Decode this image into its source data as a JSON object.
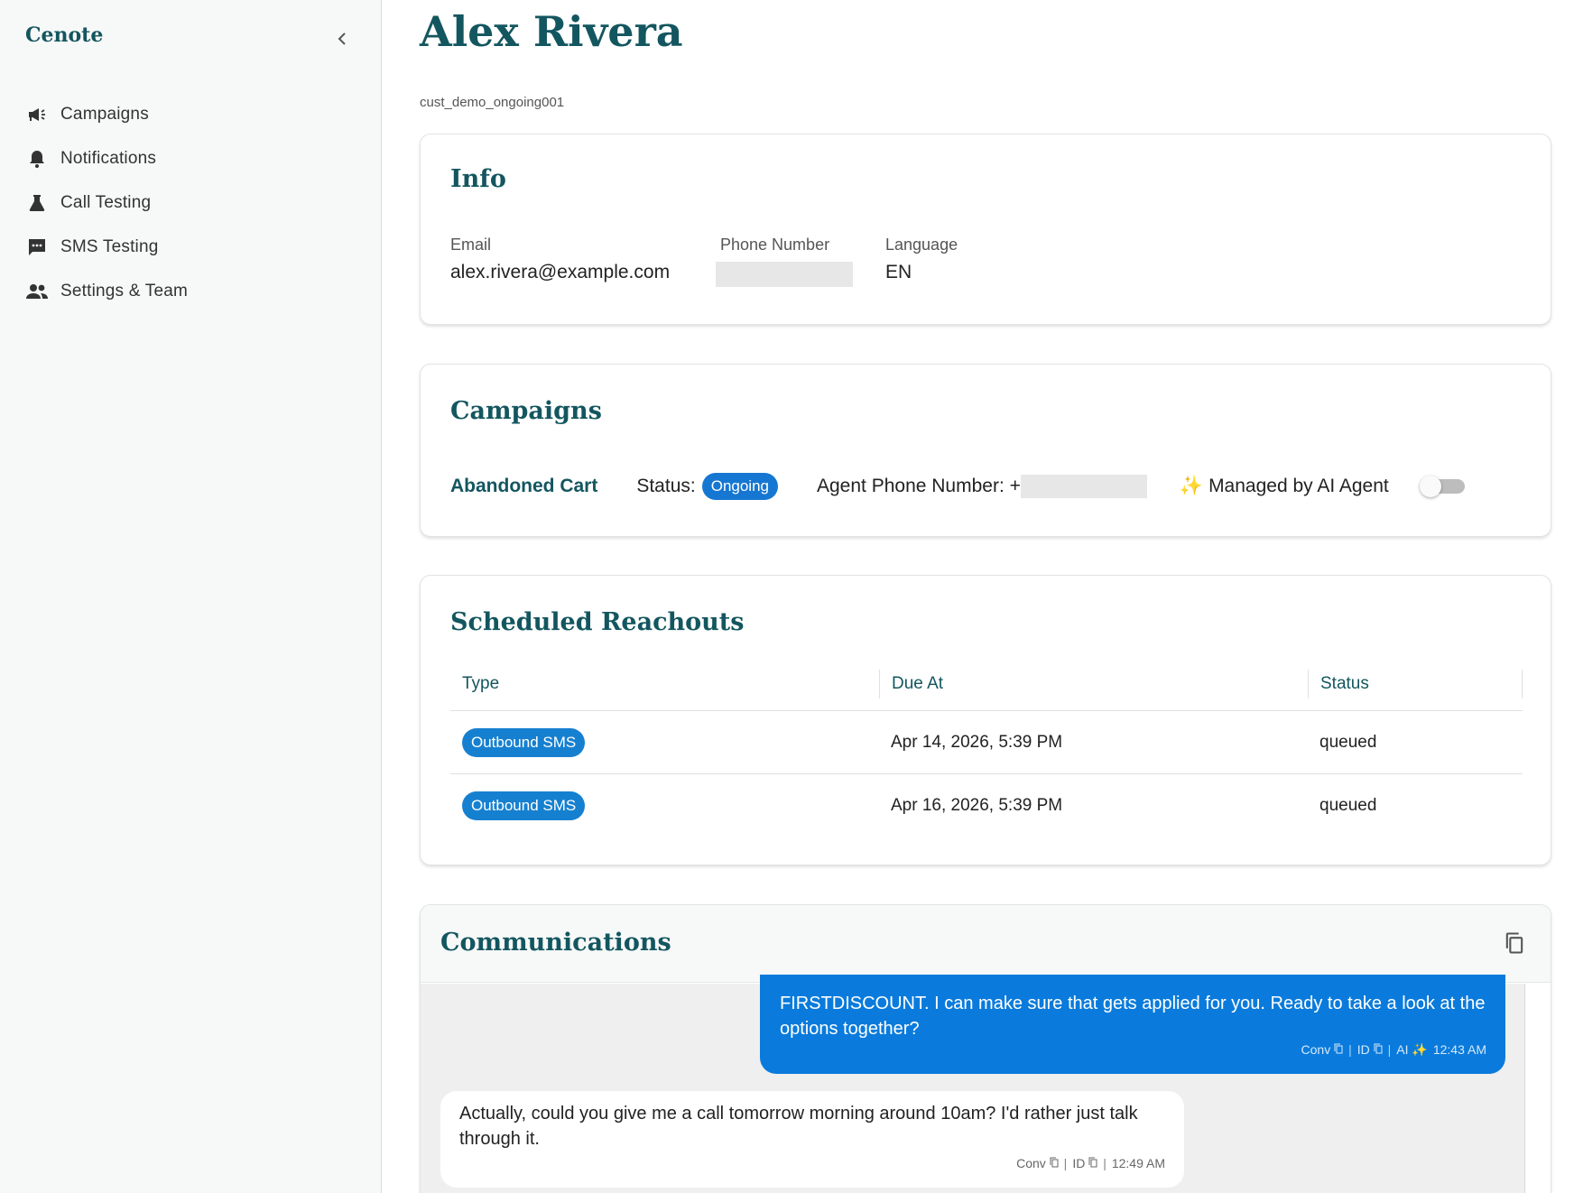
{
  "sidebar": {
    "brand": "Cenote",
    "items": [
      {
        "label": "Campaigns",
        "icon": "megaphone-icon"
      },
      {
        "label": "Notifications",
        "icon": "bell-icon"
      },
      {
        "label": "Call Testing",
        "icon": "flask-icon"
      },
      {
        "label": "SMS Testing",
        "icon": "chat-icon"
      },
      {
        "label": "Settings & Team",
        "icon": "people-icon"
      }
    ]
  },
  "customer": {
    "name": "Alex Rivera",
    "id": "cust_demo_ongoing001"
  },
  "info": {
    "title": "Info",
    "email_label": "Email",
    "email": "alex.rivera@example.com",
    "phone_label": "Phone Number",
    "language_label": "Language",
    "language": "EN"
  },
  "campaigns": {
    "title": "Campaigns",
    "name": "Abandoned Cart",
    "status_label": "Status:",
    "status": "Ongoing",
    "agent_phone_label": "Agent Phone Number: +",
    "managed_icon": "✨",
    "managed_label": "Managed by AI Agent",
    "managed_enabled": false
  },
  "reachouts": {
    "title": "Scheduled Reachouts",
    "columns": [
      "Type",
      "Due At",
      "Status"
    ],
    "rows": [
      {
        "type": "Outbound SMS",
        "due": "Apr 14, 2026, 5:39 PM",
        "status": "queued"
      },
      {
        "type": "Outbound SMS",
        "due": "Apr 16, 2026, 5:39 PM",
        "status": "queued"
      }
    ]
  },
  "communications": {
    "title": "Communications",
    "messages": [
      {
        "direction": "outbound",
        "text": "FIRSTDISCOUNT. I can make sure that gets applied for you. Ready to take a look at the options together?",
        "conv": "Conv",
        "id": "ID",
        "ai": "AI ✨",
        "time": "12:43 AM"
      },
      {
        "direction": "inbound",
        "text": "Actually, could you give me a call tomorrow morning around 10am? I'd rather just talk through it.",
        "conv": "Conv",
        "id": "ID",
        "time": "12:49 AM"
      }
    ]
  },
  "colors": {
    "brand": "#13565f",
    "accent": "#1677d2",
    "outbound_bubble": "#0a7bdc"
  }
}
